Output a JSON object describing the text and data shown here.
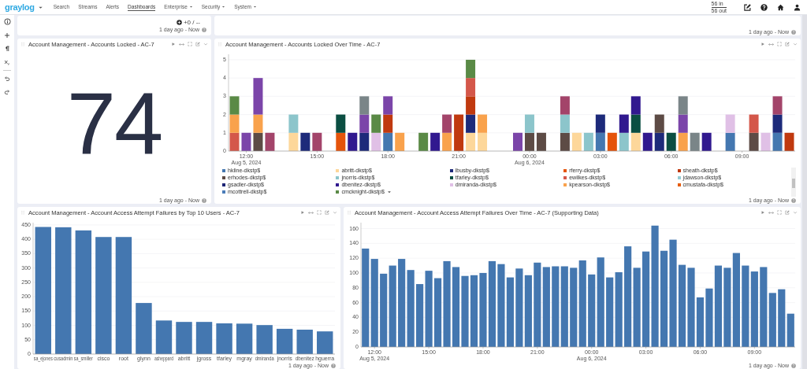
{
  "nav": {
    "logo": "graylog",
    "items": [
      {
        "label": "Search",
        "kind": "link",
        "selected": false
      },
      {
        "label": "Streams",
        "kind": "link",
        "selected": false
      },
      {
        "label": "Alerts",
        "kind": "link",
        "selected": false
      },
      {
        "label": "Dashboards",
        "kind": "link",
        "selected": true
      },
      {
        "label": "Enterprise",
        "kind": "menu",
        "selected": false
      },
      {
        "label": "Security",
        "kind": "menu",
        "selected": false
      },
      {
        "label": "System",
        "kind": "menu",
        "selected": false
      }
    ],
    "throughput": {
      "in": "56 in",
      "out": "56 out"
    }
  },
  "rows": [
    {
      "widgets": [
        {
          "kind": "summary",
          "summary": "+0 / --",
          "timerange": "1 day ago - Now"
        },
        {
          "kind": "empty",
          "timerange": "1 day ago - Now"
        }
      ]
    },
    {
      "widgets": [
        {
          "kind": "number",
          "title": "Account Management - Accounts Locked - AC-7",
          "value": "74",
          "timerange": "1 day ago - Now"
        },
        {
          "kind": "stacked_chart",
          "title": "Account Management - Accounts Locked Over Time - AC-7",
          "timerange": "1 day ago - Now",
          "legend_more": true,
          "chart_data": {
            "type": "bar",
            "stacked": true,
            "grid": true,
            "ylim": [
              0,
              5.3
            ],
            "yticks": [
              0,
              1,
              2,
              3,
              4,
              5
            ],
            "xlim": [
              "2024-08-05T11:15",
              "2024-08-06T11:15"
            ],
            "x": [
              "2024-08-05T11:30",
              "2024-08-05T12:00",
              "2024-08-05T12:30",
              "2024-08-05T13:00",
              "2024-08-05T13:30",
              "2024-08-05T14:00",
              "2024-08-05T14:30",
              "2024-08-05T15:00",
              "2024-08-05T15:30",
              "2024-08-05T16:00",
              "2024-08-05T16:30",
              "2024-08-05T17:00",
              "2024-08-05T17:30",
              "2024-08-05T18:00",
              "2024-08-05T18:30",
              "2024-08-05T19:00",
              "2024-08-05T19:30",
              "2024-08-05T20:00",
              "2024-08-05T20:30",
              "2024-08-05T21:00",
              "2024-08-05T21:30",
              "2024-08-05T22:00",
              "2024-08-05T22:30",
              "2024-08-05T23:00",
              "2024-08-05T23:30",
              "2024-08-06T00:00",
              "2024-08-06T00:30",
              "2024-08-06T01:00",
              "2024-08-06T01:30",
              "2024-08-06T02:00",
              "2024-08-06T02:30",
              "2024-08-06T03:00",
              "2024-08-06T03:30",
              "2024-08-06T04:00",
              "2024-08-06T04:30",
              "2024-08-06T05:00",
              "2024-08-06T05:30",
              "2024-08-06T06:00",
              "2024-08-06T06:30",
              "2024-08-06T07:00",
              "2024-08-06T07:30",
              "2024-08-06T08:00",
              "2024-08-06T08:30",
              "2024-08-06T09:00",
              "2024-08-06T09:30",
              "2024-08-06T10:00",
              "2024-08-06T10:30",
              "2024-08-06T11:00"
            ],
            "xticks": [
              {
                "value": "2024-08-05T12:00",
                "label": "12:00\nAug 5, 2024"
              },
              {
                "value": "2024-08-05T15:00",
                "label": "15:00"
              },
              {
                "value": "2024-08-05T18:00",
                "label": "18:00"
              },
              {
                "value": "2024-08-05T21:00",
                "label": "21:00"
              },
              {
                "value": "2024-08-06T00:00",
                "label": "00:00\nAug 6, 2024"
              },
              {
                "value": "2024-08-06T03:00",
                "label": "03:00"
              },
              {
                "value": "2024-08-06T06:00",
                "label": "06:00"
              },
              {
                "value": "2024-08-06T09:00",
                "label": "09:00"
              }
            ],
            "series": [
              {
                "name": "hkline-dkstp$",
                "color": "#4477b0",
                "values": [
                  0,
                  0,
                  0,
                  0,
                  0,
                  0,
                  0,
                  0,
                  0,
                  0,
                  0,
                  0,
                  0,
                  1,
                  0,
                  0,
                  0,
                  0,
                  0,
                  0,
                  0,
                  0,
                  0,
                  0,
                  0,
                  0,
                  0,
                  0,
                  0,
                  0,
                  0,
                  1,
                  0,
                  0,
                  0,
                  0,
                  0,
                  0,
                  0,
                  0,
                  0,
                  0,
                  1,
                  0,
                  0,
                  0,
                  1,
                  0
                ]
              },
              {
                "name": "abritt-dkstp$",
                "color": "#fdd79a",
                "values": [
                  0,
                  0,
                  0,
                  0,
                  0,
                  1,
                  0,
                  0,
                  0,
                  0,
                  0,
                  0,
                  0,
                  0,
                  0,
                  0,
                  0,
                  0,
                  0,
                  0,
                  1,
                  1,
                  0,
                  0,
                  0,
                  0,
                  0,
                  0,
                  0,
                  1,
                  0,
                  0,
                  0,
                  0,
                  1,
                  0,
                  0,
                  0,
                  0,
                  0,
                  0,
                  0,
                  0,
                  0,
                  0,
                  0,
                  0,
                  0
                ]
              },
              {
                "name": "lbusby-dkstp$",
                "color": "#1d2a7a",
                "values": [
                  0,
                  0,
                  0,
                  0,
                  0,
                  0,
                  1,
                  0,
                  0,
                  0,
                  0,
                  1,
                  0,
                  0,
                  0,
                  0,
                  0,
                  0,
                  0,
                  0,
                  1,
                  0,
                  0,
                  0,
                  0,
                  0,
                  0,
                  0,
                  0,
                  0,
                  0,
                  1,
                  0,
                  0,
                  0,
                  0,
                  1,
                  0,
                  0,
                  0,
                  0,
                  0,
                  0,
                  0,
                  0,
                  0,
                  1,
                  0
                ]
              },
              {
                "name": "rferry-dkstp$",
                "color": "#e5540b",
                "values": [
                  0,
                  0,
                  0,
                  0,
                  0,
                  0,
                  0,
                  0,
                  0,
                  1,
                  0,
                  0,
                  0,
                  0,
                  0,
                  0,
                  0,
                  0,
                  0,
                  0,
                  0,
                  0,
                  0,
                  0,
                  0,
                  0,
                  0,
                  0,
                  0,
                  0,
                  0,
                  0,
                  1,
                  0,
                  0,
                  0,
                  0,
                  0,
                  0,
                  0,
                  0,
                  0,
                  0,
                  0,
                  0,
                  0,
                  0,
                  0
                ]
              },
              {
                "name": "sheath-dkstp$",
                "color": "#c0390f",
                "values": [
                  0,
                  0,
                  0,
                  0,
                  0,
                  0,
                  0,
                  0,
                  0,
                  0,
                  0,
                  0,
                  0,
                  1,
                  0,
                  0,
                  0,
                  0,
                  0,
                  2,
                  1,
                  0,
                  0,
                  0,
                  0,
                  0,
                  0,
                  0,
                  0,
                  0,
                  0,
                  0,
                  0,
                  0,
                  0,
                  0,
                  0,
                  0,
                  0,
                  0,
                  0,
                  0,
                  0,
                  0,
                  0,
                  0,
                  0,
                  1
                ]
              },
              {
                "name": "erhodes-dkstp$",
                "color": "#5d4b45",
                "values": [
                  0,
                  0,
                  1,
                  0,
                  0,
                  0,
                  0,
                  0,
                  0,
                  0,
                  0,
                  0,
                  0,
                  0,
                  0,
                  0,
                  0,
                  0,
                  0,
                  0,
                  0,
                  0,
                  0,
                  0,
                  0,
                  1,
                  1,
                  0,
                  1,
                  0,
                  0,
                  0,
                  0,
                  0,
                  0,
                  0,
                  1,
                  0,
                  0,
                  0,
                  0,
                  0,
                  0,
                  0,
                  1,
                  0,
                  0,
                  0
                ]
              },
              {
                "name": "jnorris-dkstp$",
                "color": "#8cc5cb",
                "values": [
                  0,
                  0,
                  0,
                  0,
                  0,
                  1,
                  0,
                  0,
                  0,
                  0,
                  0,
                  0,
                  0,
                  0,
                  0,
                  0,
                  0,
                  0,
                  0,
                  0,
                  0,
                  0,
                  0,
                  0,
                  0,
                  1,
                  0,
                  0,
                  1,
                  0,
                  1,
                  0,
                  0,
                  1,
                  0,
                  0,
                  0,
                  0,
                  0,
                  0,
                  0,
                  0,
                  0,
                  0,
                  0,
                  0,
                  0,
                  0
                ]
              },
              {
                "name": "tfarley-dkstp$",
                "color": "#0b4e42",
                "values": [
                  0,
                  0,
                  0,
                  0,
                  0,
                  0,
                  0,
                  0,
                  0,
                  1,
                  0,
                  0,
                  0,
                  0,
                  0,
                  0,
                  0,
                  0,
                  0,
                  0,
                  0,
                  0,
                  0,
                  0,
                  0,
                  0,
                  0,
                  0,
                  0,
                  0,
                  0,
                  0,
                  0,
                  0,
                  1,
                  0,
                  0,
                  1,
                  0,
                  0,
                  0,
                  0,
                  0,
                  0,
                  0,
                  0,
                  0,
                  0
                ]
              },
              {
                "name": "ewilkes-dkstp$",
                "color": "#d4574a",
                "values": [
                  1,
                  0,
                  0,
                  0,
                  0,
                  0,
                  0,
                  0,
                  0,
                  0,
                  0,
                  0,
                  0,
                  0,
                  0,
                  0,
                  0,
                  0,
                  0,
                  0,
                  1,
                  0,
                  0,
                  0,
                  0,
                  0,
                  0,
                  0,
                  0,
                  0,
                  0,
                  0,
                  0,
                  0,
                  0,
                  0,
                  0,
                  0,
                  0,
                  0,
                  0,
                  0,
                  0,
                  0,
                  1,
                  0,
                  0,
                  0
                ]
              },
              {
                "name": "jdawson-dkstp$",
                "color": "#94ccd4",
                "values": [
                  0,
                  0,
                  0,
                  0,
                  0,
                  0,
                  0,
                  0,
                  0,
                  0,
                  0,
                  0,
                  0,
                  0,
                  0,
                  0,
                  0,
                  0,
                  0,
                  0,
                  0,
                  0,
                  0,
                  0,
                  0,
                  0,
                  0,
                  0,
                  0,
                  0,
                  0,
                  0,
                  0,
                  0,
                  0,
                  0,
                  0,
                  0,
                  0,
                  0,
                  0,
                  0,
                  0,
                  0,
                  0,
                  0,
                  0,
                  0
                ]
              },
              {
                "name": "gsadler-dkstp$",
                "color": "#1d2575",
                "values": [
                  0,
                  0,
                  0,
                  0,
                  0,
                  0,
                  0,
                  0,
                  0,
                  0,
                  0,
                  0,
                  0,
                  0,
                  0,
                  0,
                  0,
                  0,
                  0,
                  0,
                  0,
                  0,
                  0,
                  0,
                  0,
                  0,
                  0,
                  0,
                  0,
                  0,
                  0,
                  0,
                  0,
                  0,
                  0,
                  0,
                  0,
                  0,
                  0,
                  0,
                  0,
                  0,
                  0,
                  0,
                  0,
                  0,
                  0,
                  0
                ]
              },
              {
                "name": "dbenitez-dkstp$",
                "color": "#31198f",
                "values": [
                  0,
                  0,
                  0,
                  0,
                  0,
                  0,
                  0,
                  0,
                  0,
                  0,
                  1,
                  0,
                  0,
                  0,
                  0,
                  0,
                  0,
                  1,
                  0,
                  0,
                  0,
                  0,
                  0,
                  0,
                  0,
                  0,
                  0,
                  0,
                  0,
                  0,
                  0,
                  0,
                  0,
                  1,
                  1,
                  1,
                  0,
                  0,
                  0,
                  0,
                  1,
                  0,
                  0,
                  0,
                  0,
                  0,
                  0,
                  0
                ]
              },
              {
                "name": "dmiranda-dkstp$",
                "color": "#e0c0e6",
                "values": [
                  0,
                  0,
                  0,
                  0,
                  0,
                  0,
                  0,
                  0,
                  0,
                  0,
                  0,
                  0,
                  1,
                  0,
                  0,
                  0,
                  0,
                  0,
                  0,
                  0,
                  0,
                  0,
                  0,
                  0,
                  0,
                  0,
                  0,
                  0,
                  0,
                  0,
                  0,
                  0,
                  0,
                  0,
                  0,
                  0,
                  0,
                  0,
                  0,
                  0,
                  0,
                  0,
                  1,
                  0,
                  0,
                  1,
                  0,
                  0
                ]
              },
              {
                "name": "kpearson-dkstp$",
                "color": "#f9a24c",
                "values": [
                  1,
                  0,
                  1,
                  0,
                  0,
                  0,
                  0,
                  0,
                  0,
                  0,
                  0,
                  0,
                  0,
                  0,
                  1,
                  0,
                  0,
                  0,
                  1,
                  0,
                  0,
                  1,
                  0,
                  0,
                  0,
                  0,
                  0,
                  0,
                  0,
                  0,
                  0,
                  0,
                  0,
                  0,
                  0,
                  0,
                  0,
                  0,
                  1,
                  0,
                  0,
                  0,
                  0,
                  0,
                  0,
                  0,
                  0,
                  0
                ]
              },
              {
                "name": "cmustafa-dkstp$",
                "color": "#e65c0c",
                "values": [
                  0,
                  0,
                  0,
                  0,
                  0,
                  0,
                  0,
                  0,
                  0,
                  0,
                  0,
                  0,
                  0,
                  0,
                  0,
                  0,
                  0,
                  0,
                  0,
                  0,
                  0,
                  0,
                  0,
                  0,
                  0,
                  0,
                  0,
                  0,
                  0,
                  0,
                  0,
                  0,
                  0,
                  0,
                  0,
                  0,
                  0,
                  0,
                  0,
                  0,
                  0,
                  0,
                  0,
                  0,
                  0,
                  0,
                  0,
                  0
                ]
              },
              {
                "name": "mcottrell-dkstp$",
                "color": "#4a7cb8",
                "values": [
                  0,
                  0,
                  0,
                  0,
                  0,
                  0,
                  0,
                  0,
                  0,
                  0,
                  0,
                  0,
                  0,
                  0,
                  0,
                  0,
                  0,
                  0,
                  0,
                  0,
                  0,
                  0,
                  0,
                  0,
                  0,
                  0,
                  0,
                  0,
                  0,
                  0,
                  0,
                  0,
                  0,
                  0,
                  0,
                  0,
                  0,
                  0,
                  0,
                  0,
                  0,
                  0,
                  0,
                  0,
                  0,
                  0,
                  0,
                  0
                ]
              },
              {
                "name": "cmcknight-dkstp$",
                "color": "#5a8a46",
                "values": [
                  1,
                  0,
                  0,
                  0,
                  0,
                  0,
                  0,
                  0,
                  0,
                  0,
                  0,
                  0,
                  1,
                  0,
                  0,
                  0,
                  1,
                  0,
                  0,
                  0,
                  1,
                  0,
                  0,
                  0,
                  0,
                  0,
                  0,
                  0,
                  0,
                  0,
                  0,
                  0,
                  0,
                  0,
                  0,
                  0,
                  0,
                  0,
                  0,
                  0,
                  0,
                  0,
                  0,
                  0,
                  0,
                  0,
                  0,
                  0
                ]
              },
              {
                "color": "#7b45a9",
                "values": [
                  0,
                  1,
                  2,
                  0,
                  0,
                  0,
                  0,
                  0,
                  0,
                  0,
                  0,
                  1,
                  0,
                  1,
                  0,
                  0,
                  0,
                  0,
                  0,
                  0,
                  0,
                  0,
                  0,
                  0,
                  1,
                  0,
                  0,
                  0,
                  0,
                  0,
                  0,
                  0,
                  0,
                  0,
                  0,
                  0,
                  0,
                  0,
                  1,
                  0,
                  0,
                  0,
                  0,
                  0,
                  0,
                  0,
                  0,
                  0
                ]
              },
              {
                "color": "#7a8588",
                "values": [
                  0,
                  0,
                  0,
                  0,
                  0,
                  0,
                  0,
                  0,
                  0,
                  0,
                  0,
                  1,
                  0,
                  0,
                  0,
                  0,
                  0,
                  0,
                  0,
                  0,
                  0,
                  0,
                  0,
                  0,
                  0,
                  0,
                  0,
                  0,
                  0,
                  0,
                  0,
                  0,
                  0,
                  0,
                  0,
                  0,
                  0,
                  0,
                  1,
                  1,
                  0,
                  0,
                  0,
                  0,
                  0,
                  0,
                  0,
                  0
                ]
              },
              {
                "color": "#a3446a",
                "values": [
                  0,
                  0,
                  0,
                  1,
                  0,
                  0,
                  0,
                  1,
                  0,
                  0,
                  0,
                  0,
                  0,
                  0,
                  0,
                  0,
                  0,
                  0,
                  1,
                  0,
                  0,
                  0,
                  0,
                  0,
                  0,
                  0,
                  0,
                  0,
                  1,
                  0,
                  0,
                  0,
                  0,
                  0,
                  0,
                  0,
                  0,
                  0,
                  0,
                  0,
                  0,
                  0,
                  0,
                  0,
                  0,
                  0,
                  1,
                  0
                ]
              }
            ]
          }
        }
      ]
    },
    {
      "widgets": [
        {
          "kind": "bar_chart",
          "title": "Account Management - Account Access Attempt Failures by Top 10 Users - AC-7",
          "timerange": "1 day ago - Now",
          "chart_data": {
            "type": "bar",
            "grid": true,
            "ylim": [
              0,
              458
            ],
            "yticks": [
              0,
              50,
              100,
              150,
              200,
              250,
              300,
              350,
              400,
              450
            ],
            "categories": [
              "sa_ejones",
              "cusadmin",
              "sa_smiller",
              "cisco",
              "root",
              "glynn",
              "asheppard",
              "abritt",
              "jgross",
              "tfarley",
              "mgray",
              "dmiranda",
              "jnorris",
              "dbenitez",
              "hguerra"
            ],
            "values": [
              443,
              442,
              431,
              408,
              408,
              178,
              117,
              112,
              112,
              107,
              106,
              101,
              88,
              85,
              79
            ]
          }
        },
        {
          "kind": "bar_chart",
          "title": "Account Management - Account Access Attempt Failures Over Time - AC-7 (Supporting Data)",
          "timerange": "1 day ago - Now",
          "chart_data": {
            "type": "bar",
            "grid": true,
            "ylim": [
              0,
              168
            ],
            "yticks": [
              0,
              20,
              40,
              60,
              80,
              100,
              120,
              140,
              160
            ],
            "xlim": [
              "2024-08-05T11:15",
              "2024-08-06T11:15"
            ],
            "x": [
              "2024-08-05T11:30",
              "2024-08-05T12:00",
              "2024-08-05T12:30",
              "2024-08-05T13:00",
              "2024-08-05T13:30",
              "2024-08-05T14:00",
              "2024-08-05T14:30",
              "2024-08-05T15:00",
              "2024-08-05T15:30",
              "2024-08-05T16:00",
              "2024-08-05T16:30",
              "2024-08-05T17:00",
              "2024-08-05T17:30",
              "2024-08-05T18:00",
              "2024-08-05T18:30",
              "2024-08-05T19:00",
              "2024-08-05T19:30",
              "2024-08-05T20:00",
              "2024-08-05T20:30",
              "2024-08-05T21:00",
              "2024-08-05T21:30",
              "2024-08-05T22:00",
              "2024-08-05T22:30",
              "2024-08-05T23:00",
              "2024-08-05T23:30",
              "2024-08-06T00:00",
              "2024-08-06T00:30",
              "2024-08-06T01:00",
              "2024-08-06T01:30",
              "2024-08-06T02:00",
              "2024-08-06T02:30",
              "2024-08-06T03:00",
              "2024-08-06T03:30",
              "2024-08-06T04:00",
              "2024-08-06T04:30",
              "2024-08-06T05:00",
              "2024-08-06T05:30",
              "2024-08-06T06:00",
              "2024-08-06T06:30",
              "2024-08-06T07:00",
              "2024-08-06T07:30",
              "2024-08-06T08:00",
              "2024-08-06T08:30",
              "2024-08-06T09:00",
              "2024-08-06T09:30",
              "2024-08-06T10:00",
              "2024-08-06T10:30",
              "2024-08-06T11:00"
            ],
            "xticks": [
              {
                "value": "2024-08-05T12:00",
                "label": "12:00\nAug 5, 2024"
              },
              {
                "value": "2024-08-05T15:00",
                "label": "15:00"
              },
              {
                "value": "2024-08-05T18:00",
                "label": "18:00"
              },
              {
                "value": "2024-08-05T21:00",
                "label": "21:00"
              },
              {
                "value": "2024-08-06T00:00",
                "label": "00:00\nAug 6, 2024"
              },
              {
                "value": "2024-08-06T03:00",
                "label": "03:00"
              },
              {
                "value": "2024-08-06T06:00",
                "label": "06:00"
              },
              {
                "value": "2024-08-06T09:00",
                "label": "09:00"
              }
            ],
            "values": [
              133,
              119,
              99,
              110,
              119,
              104,
              85,
              103,
              93,
              116,
              108,
              96,
              97,
              100,
              116,
              112,
              94,
              106,
              97,
              114,
              108,
              109,
              109,
              107,
              117,
              98,
              121,
              94,
              101,
              136,
              107,
              129,
              164,
              130,
              145,
              111,
              107,
              67,
              79,
              110,
              107,
              127,
              110,
              102,
              108,
              73,
              78,
              45
            ]
          }
        }
      ]
    }
  ]
}
